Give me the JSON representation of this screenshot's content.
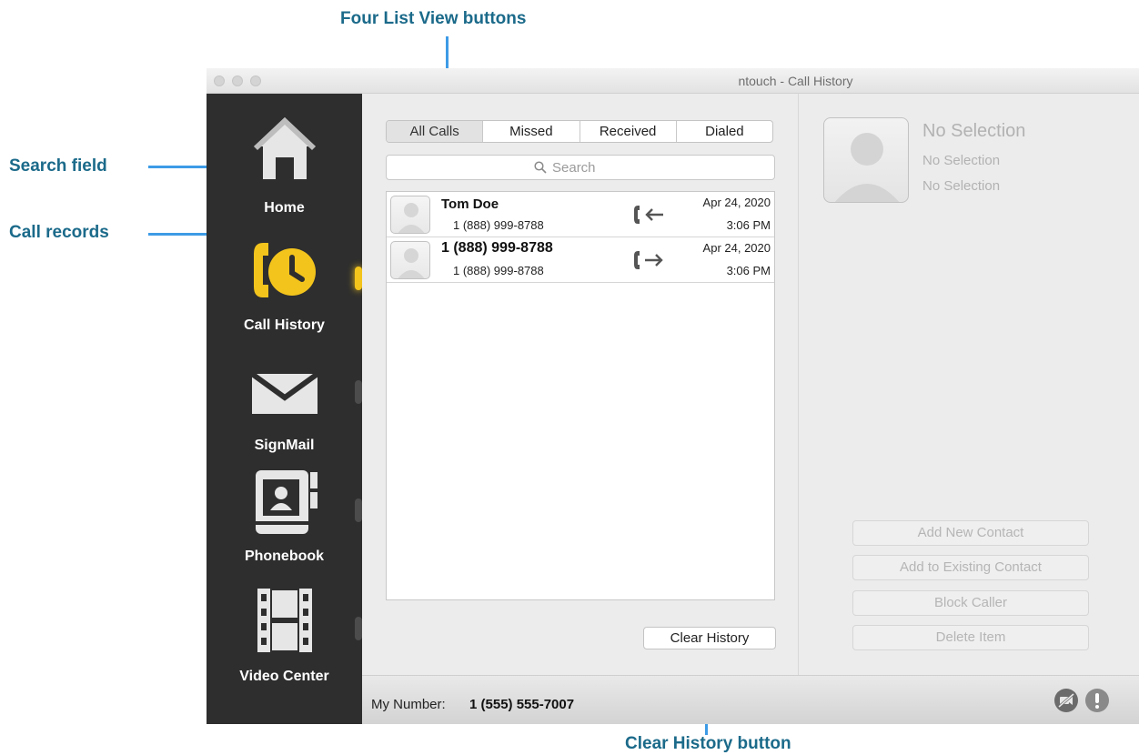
{
  "annotations": {
    "list_view_buttons": "Four List View buttons",
    "search_field": "Search field",
    "call_records": "Call records",
    "clear_history_button": "Clear History button"
  },
  "window": {
    "title": "ntouch - Call History"
  },
  "sidebar": {
    "items": [
      {
        "label": "Home",
        "icon": "home-icon",
        "active": false
      },
      {
        "label": "Call History",
        "icon": "call-history-icon",
        "active": true
      },
      {
        "label": "SignMail",
        "icon": "envelope-icon",
        "active": false
      },
      {
        "label": "Phonebook",
        "icon": "phonebook-icon",
        "active": false
      },
      {
        "label": "Video Center",
        "icon": "film-icon",
        "active": false
      }
    ]
  },
  "filters": {
    "tabs": [
      "All Calls",
      "Missed",
      "Received",
      "Dialed"
    ],
    "selected": "All Calls"
  },
  "search": {
    "placeholder": "Search"
  },
  "calls": [
    {
      "name": "Tom Doe",
      "number": "1 (888) 999-8788",
      "direction": "incoming",
      "date": "Apr 24, 2020",
      "time": "3:06 PM"
    },
    {
      "name": "1 (888) 999-8788",
      "number": "1 (888) 999-8788",
      "direction": "outgoing",
      "date": "Apr 24, 2020",
      "time": "3:06 PM"
    }
  ],
  "clear_history_label": "Clear History",
  "detail": {
    "name": "No Selection",
    "line1": "No Selection",
    "line2": "No Selection",
    "buttons": [
      "Add New Contact",
      "Add to Existing Contact",
      "Block Caller",
      "Delete Item"
    ]
  },
  "statusbar": {
    "my_number_label": "My Number:",
    "my_number": "1 (555) 555-7007"
  },
  "colors": {
    "accent_annotation": "#3d9be6",
    "annotation_text": "#1b6a8a",
    "nav_active": "#f3c41c",
    "sidebar_bg": "#2e2e2e"
  }
}
